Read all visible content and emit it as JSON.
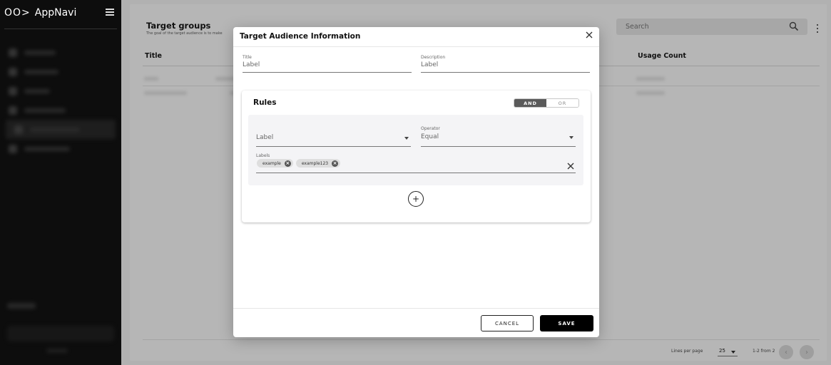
{
  "app": {
    "logo_glyphs": "OO>",
    "name": "AppNavi"
  },
  "page": {
    "title": "Target groups",
    "subtitle": "The goal of the target audience is to make",
    "search_placeholder": "Search",
    "columns": {
      "title": "Title",
      "usage_count": "Usage Count"
    }
  },
  "pagination": {
    "lines_per_page_label": "Lines per page",
    "lines_per_page_value": "25",
    "range_text": "1-2 from 2"
  },
  "dialog": {
    "title": "Target Audience Information",
    "title_field": {
      "label": "Title",
      "value": "Label"
    },
    "description_field": {
      "label": "Description",
      "value": "Label"
    },
    "rules": {
      "heading": "Rules",
      "toggle": {
        "and": "AND",
        "or": "OR",
        "selected": "AND"
      },
      "rule": {
        "attribute": {
          "value": "Label"
        },
        "operator": {
          "label": "Operator",
          "value": "Equal"
        },
        "labels": {
          "label": "Labels",
          "chips": [
            "example",
            "example123"
          ]
        }
      },
      "add_symbol": "+"
    },
    "cancel_label": "CANCEL",
    "save_label": "SAVE"
  },
  "colors": {
    "primary_button": "#000000",
    "toggle_active": "#5a5a5a",
    "rule_box_bg": "#f4f4f6"
  }
}
